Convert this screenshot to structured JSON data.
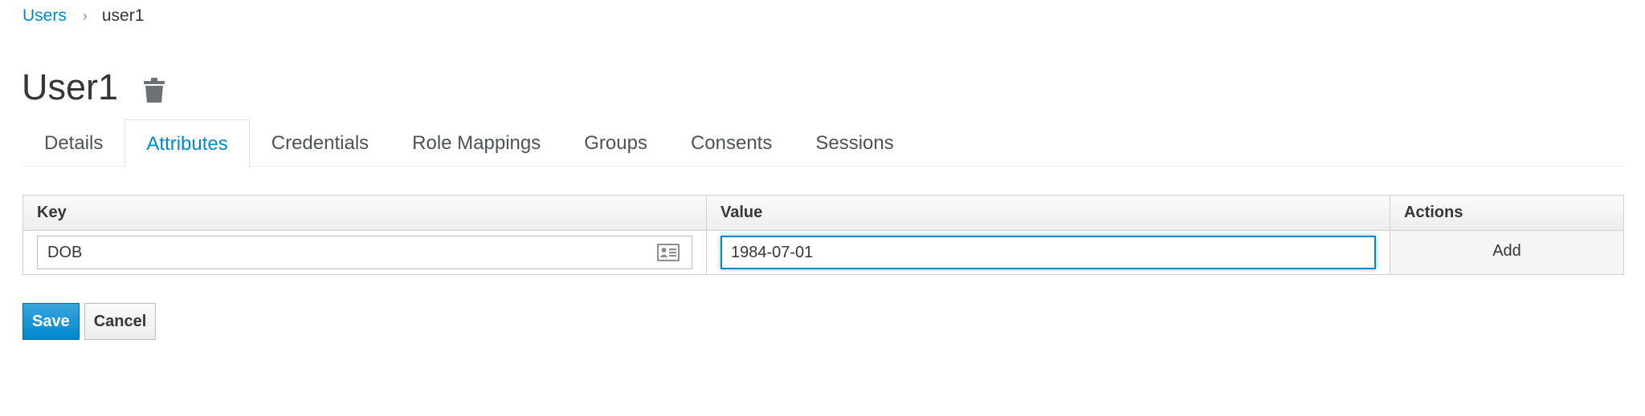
{
  "breadcrumb": {
    "parent": "Users",
    "separator": "›",
    "current": "user1"
  },
  "page": {
    "title": "User1",
    "delete_icon": "trash-icon"
  },
  "tabs": [
    {
      "label": "Details",
      "active": false
    },
    {
      "label": "Attributes",
      "active": true
    },
    {
      "label": "Credentials",
      "active": false
    },
    {
      "label": "Role Mappings",
      "active": false
    },
    {
      "label": "Groups",
      "active": false
    },
    {
      "label": "Consents",
      "active": false
    },
    {
      "label": "Sessions",
      "active": false
    }
  ],
  "table": {
    "headers": {
      "key": "Key",
      "value": "Value",
      "actions": "Actions"
    },
    "row": {
      "key": "DOB",
      "key_icon": "address-card-icon",
      "value": "1984-07-01",
      "action": "Add"
    }
  },
  "buttons": {
    "save": "Save",
    "cancel": "Cancel"
  },
  "colors": {
    "link": "#0088ce",
    "primary": "#0088ce",
    "text": "#363636"
  }
}
